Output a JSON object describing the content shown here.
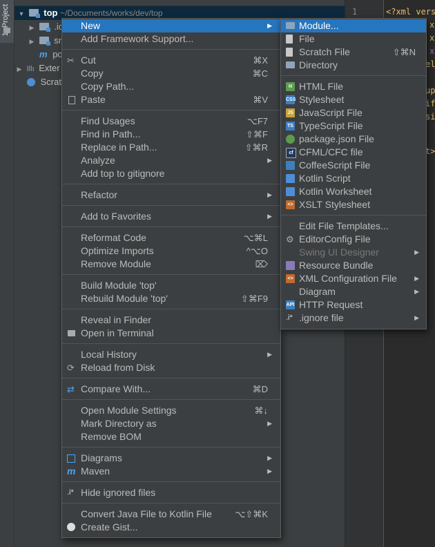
{
  "sidebar_tab": {
    "label": "1: Project"
  },
  "tree": {
    "root_name": "top",
    "root_path": "~/Documents/works/dev/top",
    "items": [
      {
        "label": ".id"
      },
      {
        "label": "src"
      },
      {
        "label": "po"
      },
      {
        "label": "Exter"
      },
      {
        "label": "Scrat"
      }
    ]
  },
  "editor": {
    "line_number": "1",
    "lines": [
      "<?xml vers",
      "x",
      "x",
      "x",
      "el",
      "up",
      "if",
      "si",
      "t>"
    ]
  },
  "context_menu": {
    "items": [
      {
        "label": "New",
        "submenu": "▶"
      },
      {
        "label": "Add Framework Support..."
      },
      {
        "label": "Cut",
        "shortcut": "⌘X"
      },
      {
        "label": "Copy",
        "shortcut": "⌘C"
      },
      {
        "label": "Copy Path..."
      },
      {
        "label": "Paste",
        "shortcut": "⌘V"
      },
      {
        "label": "Find Usages",
        "shortcut": "⌥F7"
      },
      {
        "label": "Find in Path...",
        "shortcut": "⇧⌘F"
      },
      {
        "label": "Replace in Path...",
        "shortcut": "⇧⌘R"
      },
      {
        "label": "Analyze",
        "submenu": "▶"
      },
      {
        "label": "Add top to gitignore"
      },
      {
        "label": "Refactor",
        "submenu": "▶"
      },
      {
        "label": "Add to Favorites",
        "submenu": "▶"
      },
      {
        "label": "Reformat Code",
        "shortcut": "⌥⌘L"
      },
      {
        "label": "Optimize Imports",
        "shortcut": "^⌥O"
      },
      {
        "label": "Remove Module",
        "shortcut": "⌦"
      },
      {
        "label": "Build Module 'top'"
      },
      {
        "label": "Rebuild Module 'top'",
        "shortcut": "⇧⌘F9"
      },
      {
        "label": "Reveal in Finder"
      },
      {
        "label": "Open in Terminal"
      },
      {
        "label": "Local History",
        "submenu": "▶"
      },
      {
        "label": "Reload from Disk"
      },
      {
        "label": "Compare With...",
        "shortcut": "⌘D"
      },
      {
        "label": "Open Module Settings",
        "shortcut": "⌘↓"
      },
      {
        "label": "Mark Directory as",
        "submenu": "▶"
      },
      {
        "label": "Remove BOM"
      },
      {
        "label": "Diagrams",
        "submenu": "▶"
      },
      {
        "label": "Maven",
        "submenu": "▶"
      },
      {
        "label": "Hide ignored files",
        "icon_text": ".i*"
      },
      {
        "label": "Convert Java File to Kotlin File",
        "shortcut": "⌥⇧⌘K"
      },
      {
        "label": "Create Gist..."
      }
    ]
  },
  "new_submenu": {
    "items": [
      {
        "label": "Module..."
      },
      {
        "label": "File"
      },
      {
        "label": "Scratch File",
        "shortcut": "⇧⌘N"
      },
      {
        "label": "Directory"
      },
      {
        "label": "HTML File"
      },
      {
        "label": "Stylesheet"
      },
      {
        "label": "JavaScript File"
      },
      {
        "label": "TypeScript File"
      },
      {
        "label": "package.json File"
      },
      {
        "label": "CFML/CFC file"
      },
      {
        "label": "CoffeeScript File"
      },
      {
        "label": "Kotlin Script"
      },
      {
        "label": "Kotlin Worksheet"
      },
      {
        "label": "XSLT Stylesheet"
      },
      {
        "label": "Edit File Templates..."
      },
      {
        "label": "EditorConfig File"
      },
      {
        "label": "Swing UI Designer",
        "submenu": "▶"
      },
      {
        "label": "Resource Bundle"
      },
      {
        "label": "XML Configuration File",
        "submenu": "▶"
      },
      {
        "label": "Diagram",
        "submenu": "▶"
      },
      {
        "label": "HTTP Request"
      },
      {
        "label": ".ignore file",
        "submenu": "▶",
        "icon_text": ".i*"
      }
    ]
  },
  "colors": {
    "highlight": "#2675bf",
    "menu_bg": "#3c3f41",
    "panel_bg": "#3c3f41",
    "editor_bg": "#2b2b2b"
  }
}
